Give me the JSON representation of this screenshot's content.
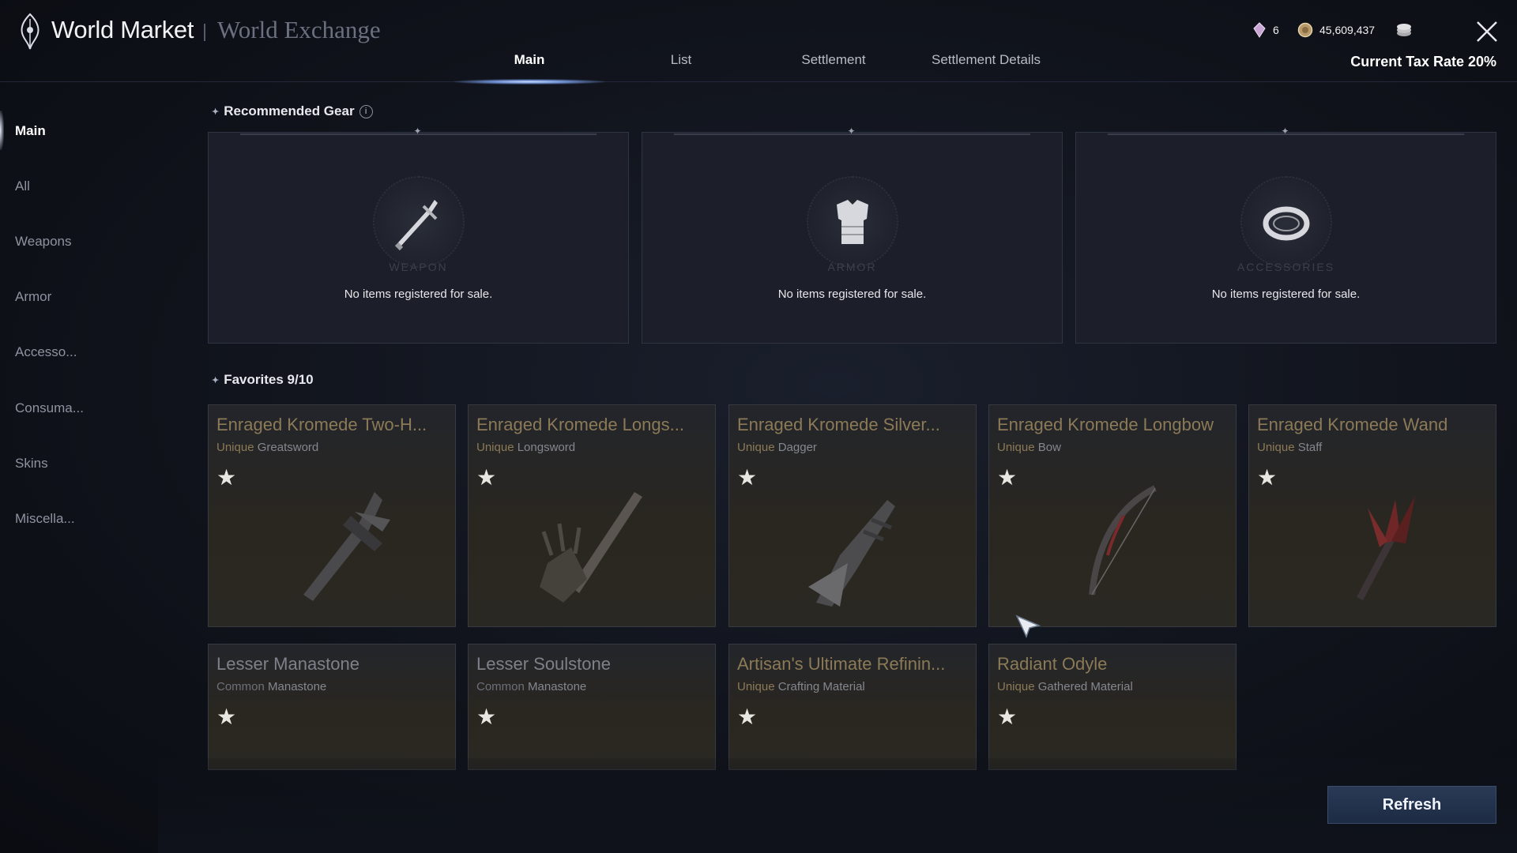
{
  "header": {
    "title": "World Market",
    "subtitle": "World Exchange",
    "tabs": [
      {
        "label": "Main",
        "active": true
      },
      {
        "label": "List",
        "active": false
      },
      {
        "label": "Settlement",
        "active": false
      },
      {
        "label": "Settlement Details",
        "active": false
      }
    ],
    "currencies": [
      {
        "icon": "gem-icon",
        "value": "6"
      },
      {
        "icon": "coin-icon",
        "value": "45,609,437"
      },
      {
        "icon": "coin-stack-icon",
        "value": ""
      }
    ],
    "tax_rate": "Current Tax Rate 20%"
  },
  "sidebar": {
    "items": [
      {
        "label": "Main",
        "active": true
      },
      {
        "label": "All",
        "active": false
      },
      {
        "label": "Weapons",
        "active": false
      },
      {
        "label": "Armor",
        "active": false
      },
      {
        "label": "Accesso...",
        "active": false
      },
      {
        "label": "Consuma...",
        "active": false
      },
      {
        "label": "Skins",
        "active": false
      },
      {
        "label": "Miscella...",
        "active": false
      }
    ]
  },
  "recommended": {
    "title": "Recommended Gear",
    "cards": [
      {
        "category": "WEAPON",
        "icon": "weapon-icon",
        "message": "No items registered for sale."
      },
      {
        "category": "ARMOR",
        "icon": "armor-icon",
        "message": "No items registered for sale."
      },
      {
        "category": "ACCESSORIES",
        "icon": "accessory-ring-icon",
        "message": "No items registered for sale."
      }
    ]
  },
  "favorites": {
    "title": "Favorites 9/10",
    "items": [
      {
        "name": "Enraged Kromede Two-H...",
        "rarity": "Unique",
        "type": "Greatsword",
        "icon": "greatsword-icon"
      },
      {
        "name": "Enraged Kromede Longs...",
        "rarity": "Unique",
        "type": "Longsword",
        "icon": "longsword-icon"
      },
      {
        "name": "Enraged Kromede Silver...",
        "rarity": "Unique",
        "type": "Dagger",
        "icon": "dagger-icon"
      },
      {
        "name": "Enraged Kromede Longbow",
        "rarity": "Unique",
        "type": "Bow",
        "icon": "bow-icon"
      },
      {
        "name": "Enraged Kromede Wand",
        "rarity": "Unique",
        "type": "Staff",
        "icon": "staff-icon"
      },
      {
        "name": "Lesser Manastone",
        "rarity": "Common",
        "type": "Manastone",
        "icon": "manastone-icon"
      },
      {
        "name": "Lesser Soulstone",
        "rarity": "Common",
        "type": "Manastone",
        "icon": "soulstone-icon"
      },
      {
        "name": "Artisan's Ultimate Refinin...",
        "rarity": "Unique",
        "type": "Crafting Material",
        "icon": "refining-stone-icon"
      },
      {
        "name": "Radiant Odyle",
        "rarity": "Unique",
        "type": "Gathered Material",
        "icon": "odyle-icon"
      }
    ]
  },
  "refresh_label": "Refresh",
  "colors": {
    "unique": "#8c7a57",
    "common": "#7f818a",
    "accent": "#1d2b44"
  }
}
